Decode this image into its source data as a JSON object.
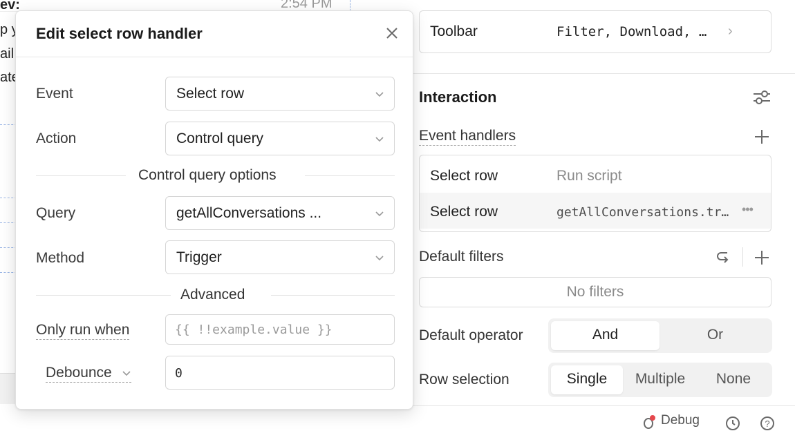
{
  "canvas": {
    "time": "2:54 PM",
    "fragments": [
      "ev:",
      "p y",
      "ail",
      "ate"
    ]
  },
  "inspector": {
    "toolbar": {
      "label": "Toolbar",
      "value": "Filter, Download, …"
    },
    "interaction": {
      "title": "Interaction"
    },
    "event_handlers": {
      "title": "Event handlers",
      "rows": [
        {
          "event": "Select row",
          "action": "Run script"
        },
        {
          "event": "Select row",
          "action": "getAllConversations.tr…"
        }
      ]
    },
    "default_filters": {
      "title": "Default filters",
      "empty_text": "No filters"
    },
    "default_operator": {
      "label": "Default operator",
      "options": [
        "And",
        "Or"
      ],
      "selected": "And"
    },
    "row_selection": {
      "label": "Row selection",
      "options": [
        "Single",
        "Multiple",
        "None"
      ],
      "selected": "Single"
    },
    "footer": {
      "debug_label": "Debug"
    }
  },
  "modal": {
    "title": "Edit select row handler",
    "event": {
      "label": "Event",
      "value": "Select row"
    },
    "action": {
      "label": "Action",
      "value": "Control query"
    },
    "options_title": "Control query options",
    "query": {
      "label": "Query",
      "value": "getAllConversations ..."
    },
    "method": {
      "label": "Method",
      "value": "Trigger"
    },
    "advanced_title": "Advanced",
    "only_run_when": {
      "label": "Only run when",
      "placeholder": "{{ !!example.value }}"
    },
    "debounce": {
      "label": "Debounce",
      "value": "0"
    }
  },
  "colors": {
    "accent_dot": "#e5484d",
    "border": "#d6d6d6",
    "muted": "#8a8a8a"
  }
}
